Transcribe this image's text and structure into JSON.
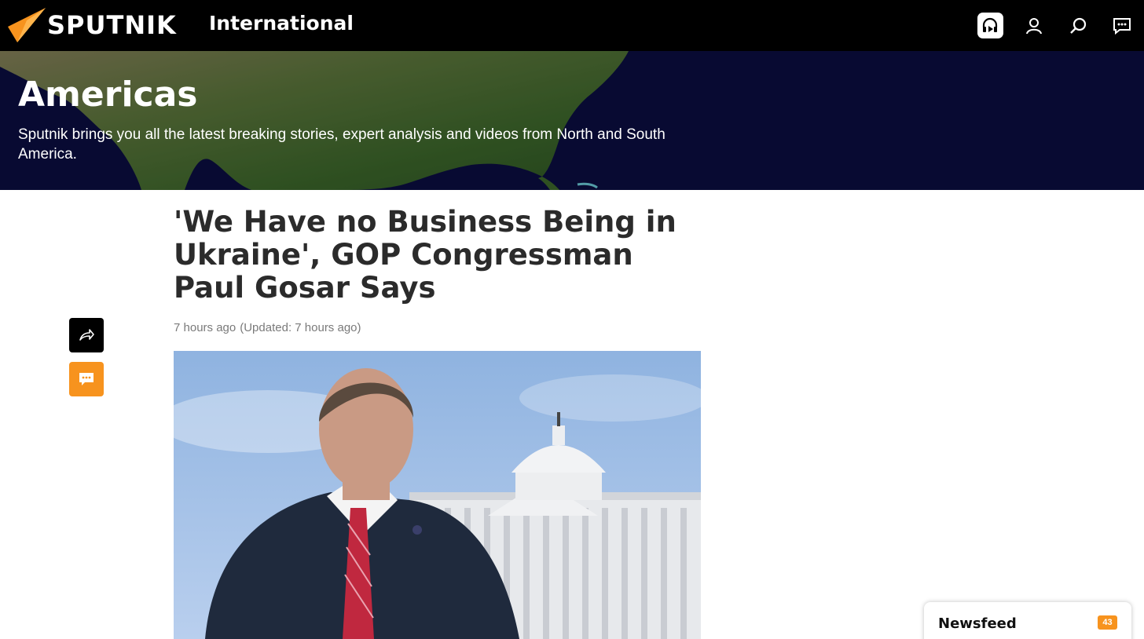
{
  "header": {
    "logo_text": "SPUTNIK",
    "edition": "International",
    "icons": [
      "radio-icon",
      "user-icon",
      "search-icon",
      "chat-icon"
    ]
  },
  "hero": {
    "title": "Americas",
    "description": "Sputnik brings you all the latest breaking stories, expert analysis and videos from North and South America."
  },
  "article": {
    "headline": "'We Have no Business Being in Ukraine', GOP Congressman Paul Gosar Says",
    "published": "7 hours ago",
    "updated": "(Updated: 7 hours ago)"
  },
  "actions": {
    "share_icon": "share-icon",
    "comment_icon": "comment-icon"
  },
  "newsfeed": {
    "label": "Newsfeed",
    "count": "43"
  },
  "colors": {
    "accent": "#f7931e",
    "topbar": "#000000",
    "hero_bg": "#0b0e3d"
  }
}
